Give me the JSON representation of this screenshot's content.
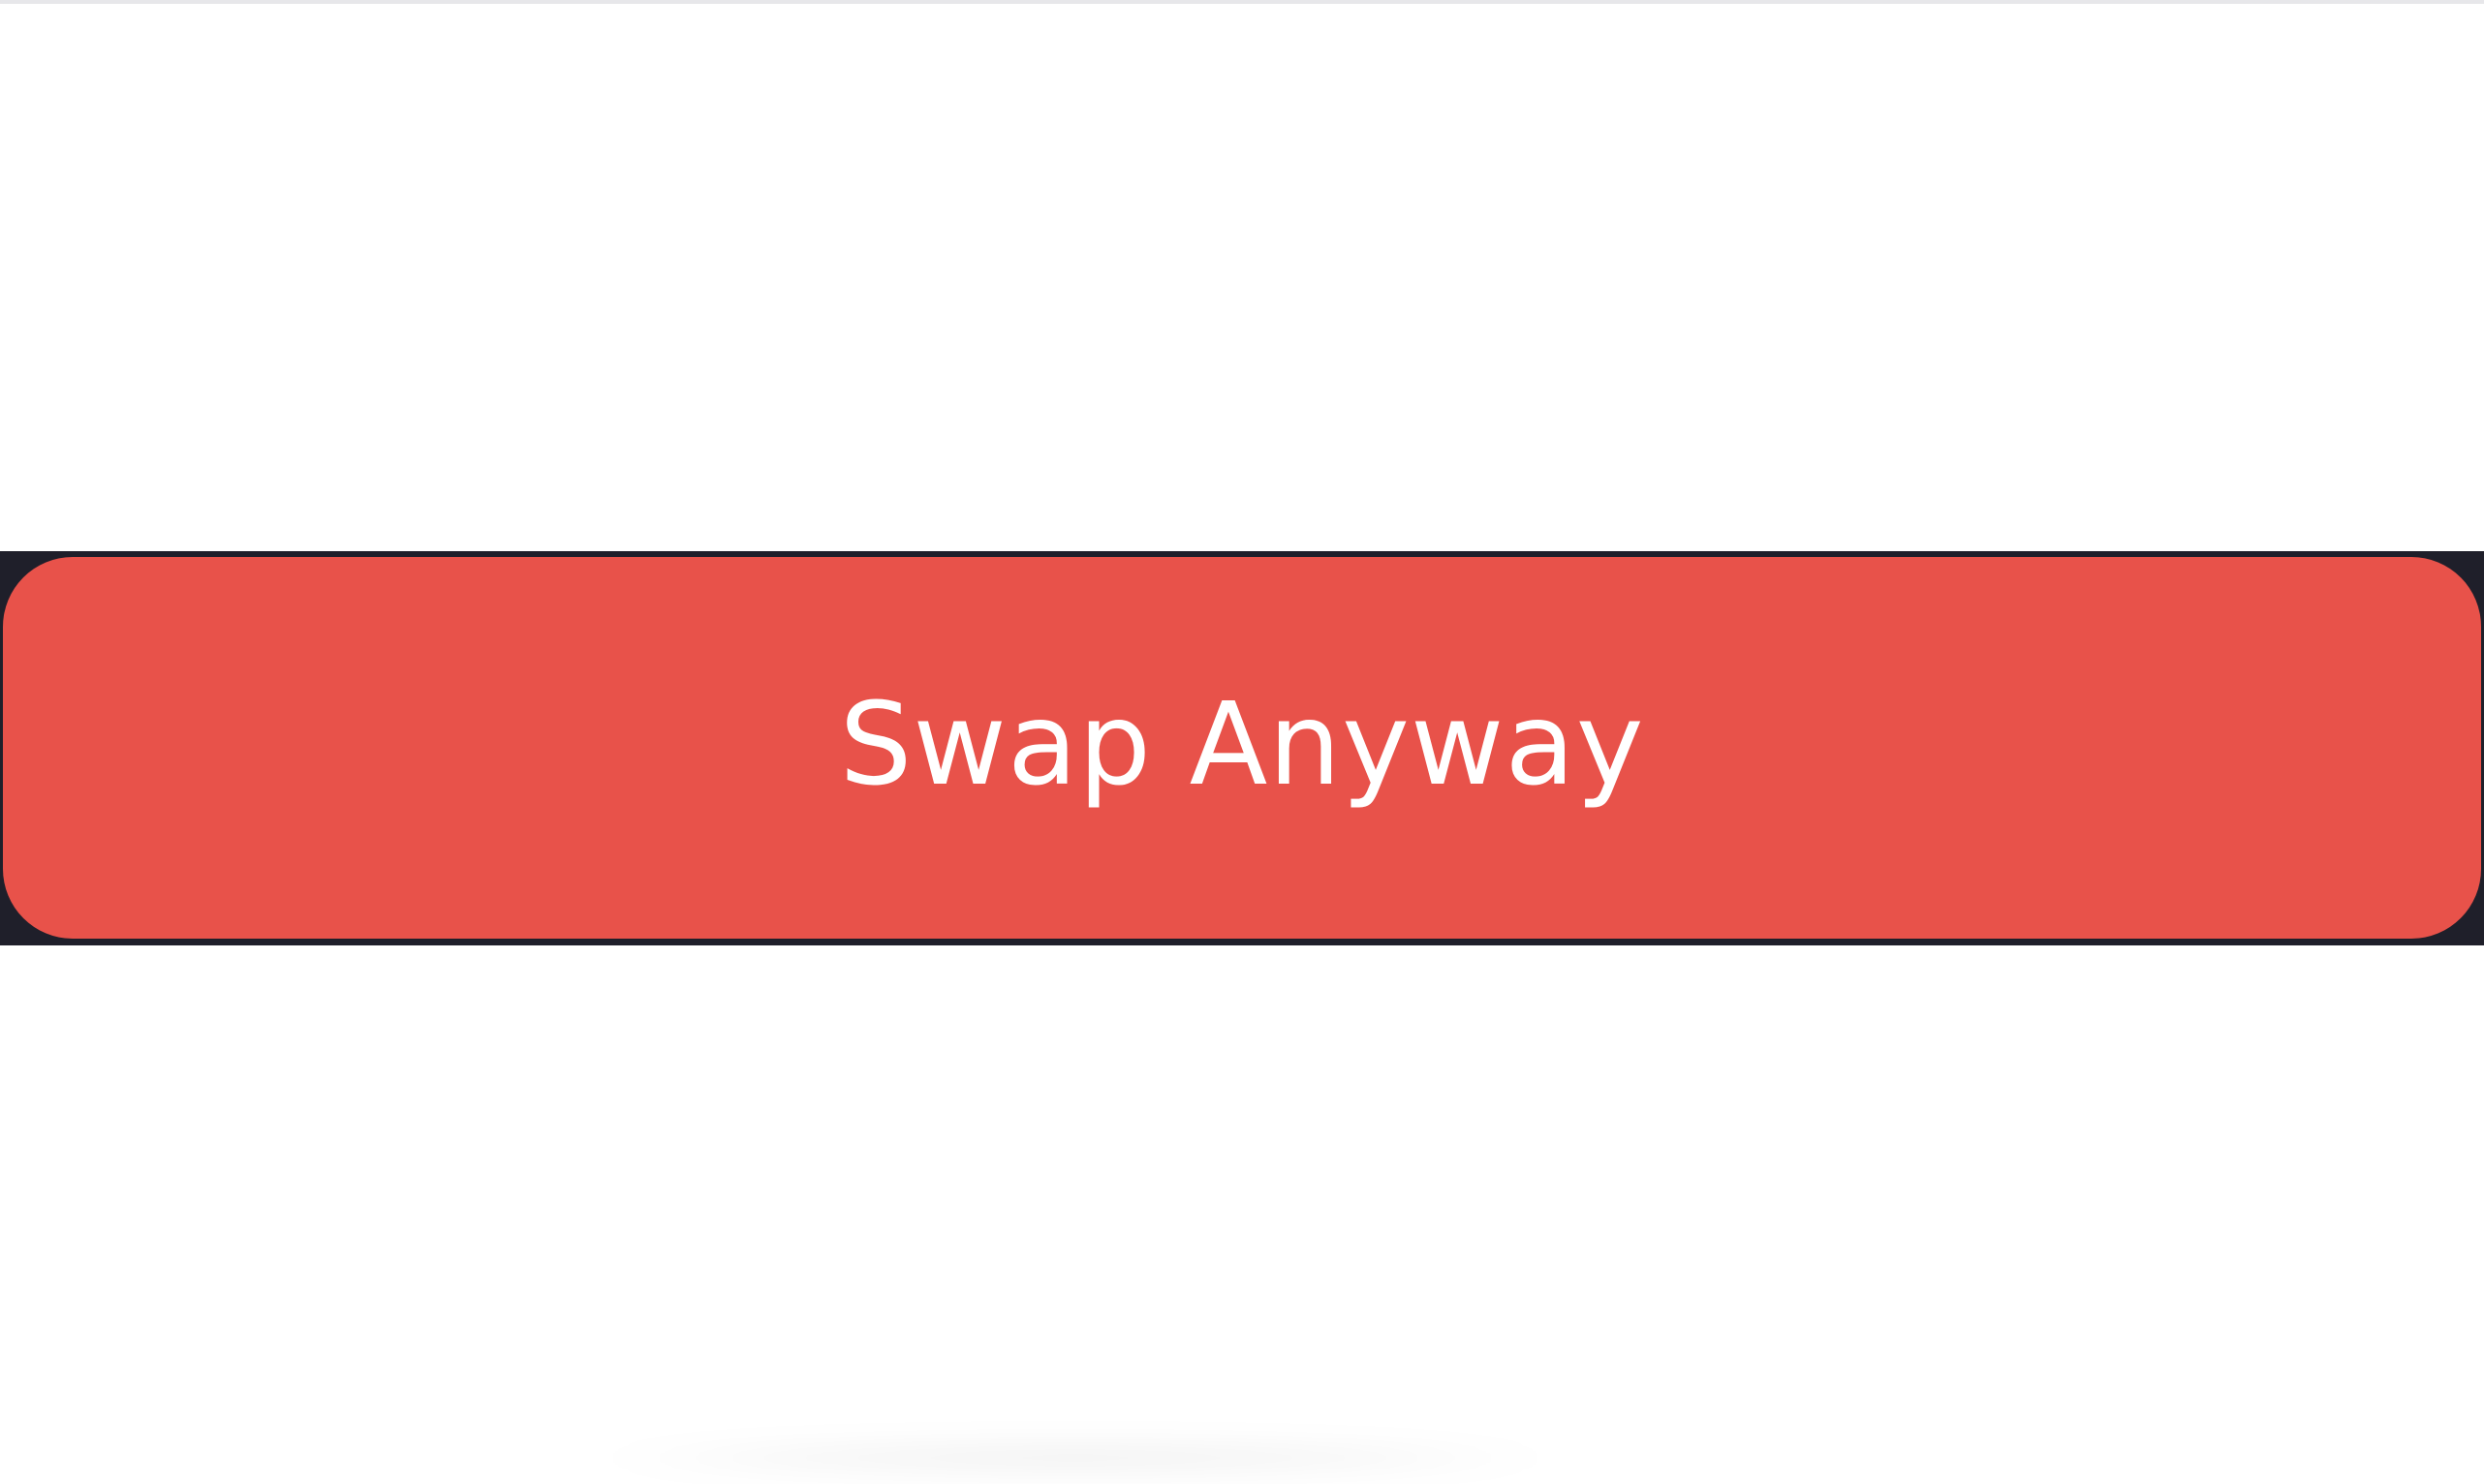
{
  "action": {
    "primary_label": "Swap Anyway"
  },
  "colors": {
    "button_background": "#e8524a",
    "button_text": "#ffffff",
    "band_background": "#1f1f2a",
    "page_background": "#ffffff"
  }
}
